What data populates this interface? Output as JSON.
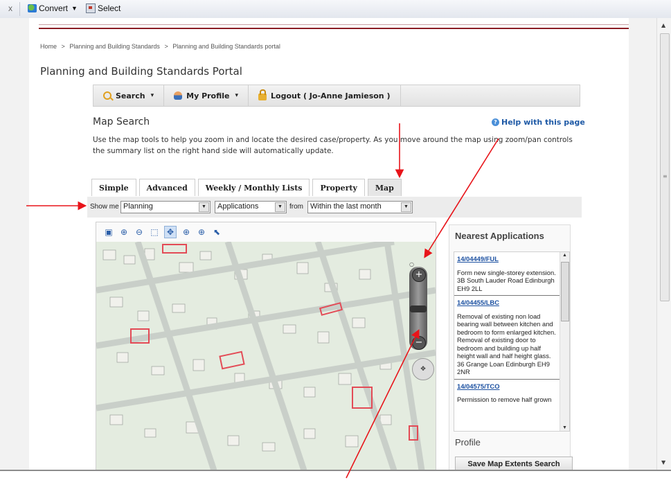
{
  "toolbar": {
    "close_glyph": "x",
    "convert_label": "Convert",
    "select_label": "Select"
  },
  "breadcrumb": [
    "Home",
    ">",
    "Planning and Building Standards",
    ">",
    "Planning and Building Standards portal"
  ],
  "portal_title": "Planning and Building Standards Portal",
  "menu": {
    "search": "Search",
    "profile": "My Profile",
    "logout": "Logout ( Jo-Anne Jamieson )"
  },
  "map_search": {
    "title": "Map Search",
    "help": "Help with this page",
    "description": "Use the map tools to help you zoom in and locate the desired case/property. As you move around the map using zoom/pan controls the summary list on the right hand side will automatically update."
  },
  "tabs": [
    "Simple",
    "Advanced",
    "Weekly / Monthly Lists",
    "Property",
    "Map"
  ],
  "active_tab": "Map",
  "filter": {
    "show_me_label": "Show me",
    "show_me_value": "Planning",
    "type_value": "Applications",
    "from_label": "from",
    "period_value": "Within the last month"
  },
  "map_tools": [
    "overview-icon",
    "zoom-in-icon",
    "zoom-out-icon",
    "zoom-box-icon",
    "pan-icon",
    "zoom-previous-icon",
    "zoom-next-icon",
    "select-pointer-icon"
  ],
  "nearest": {
    "title": "Nearest Applications",
    "items": [
      {
        "ref": "14/04449/FUL",
        "desc": "Form new single-storey extension.",
        "addr": "3B South Lauder Road Edinburgh EH9 2LL"
      },
      {
        "ref": "14/04455/LBC",
        "desc": "Removal of existing non load bearing wall between kitchen and bedroom to form enlarged kitchen. Removal of existing door to bedroom and building up half height wall and half height glass.",
        "addr": "36 Grange Loan Edinburgh EH9 2NR"
      },
      {
        "ref": "14/04575/TCO",
        "desc": "Permission to remove half grown",
        "addr": ""
      }
    ]
  },
  "profile_title": "Profile",
  "save_button": "Save Map Extents Search",
  "colors": {
    "accent_red": "#8b1d24",
    "link_blue": "#1a4fa0",
    "annotation_red": "#e8141a"
  }
}
